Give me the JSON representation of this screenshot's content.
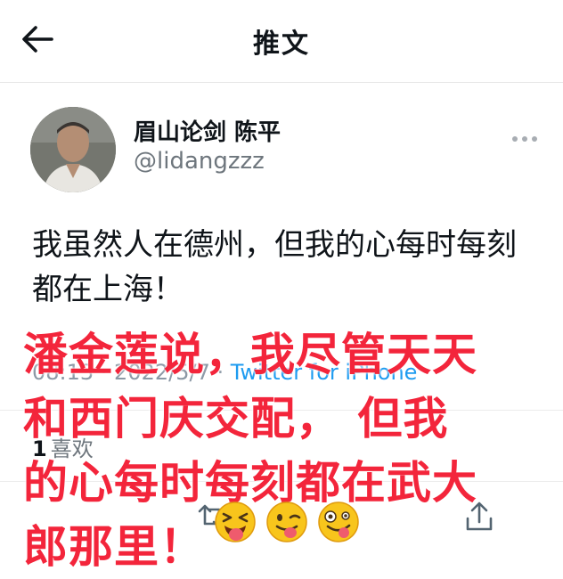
{
  "header": {
    "title": "推文"
  },
  "author": {
    "display_name": "眉山论剑 陈平",
    "handle": "@lidangzzz"
  },
  "tweet": {
    "text": "我虽然人在德州，但我的心每时每刻都在上海！",
    "time_date": "08:13 · 2022/5/7 · ",
    "source": "Twitter for iPhone"
  },
  "stats": {
    "likes_count": "1",
    "likes_label": "喜欢"
  },
  "overlay": {
    "text": "潘金莲说，我尽管天天\n和西门庆交配， 但我\n的心每时每刻都在武大\n郎那里！"
  },
  "icons": {
    "back": "arrow-left-icon",
    "more": "more-dots-icon",
    "retweet": "retweet-icon",
    "share": "share-icon",
    "emojis": [
      "laughing-tongue-emoji",
      "winking-tongue-emoji",
      "zany-face-emoji"
    ]
  },
  "colors": {
    "overlay_text": "#f3253b",
    "link": "#1d9bf0",
    "muted": "#6e767d"
  }
}
